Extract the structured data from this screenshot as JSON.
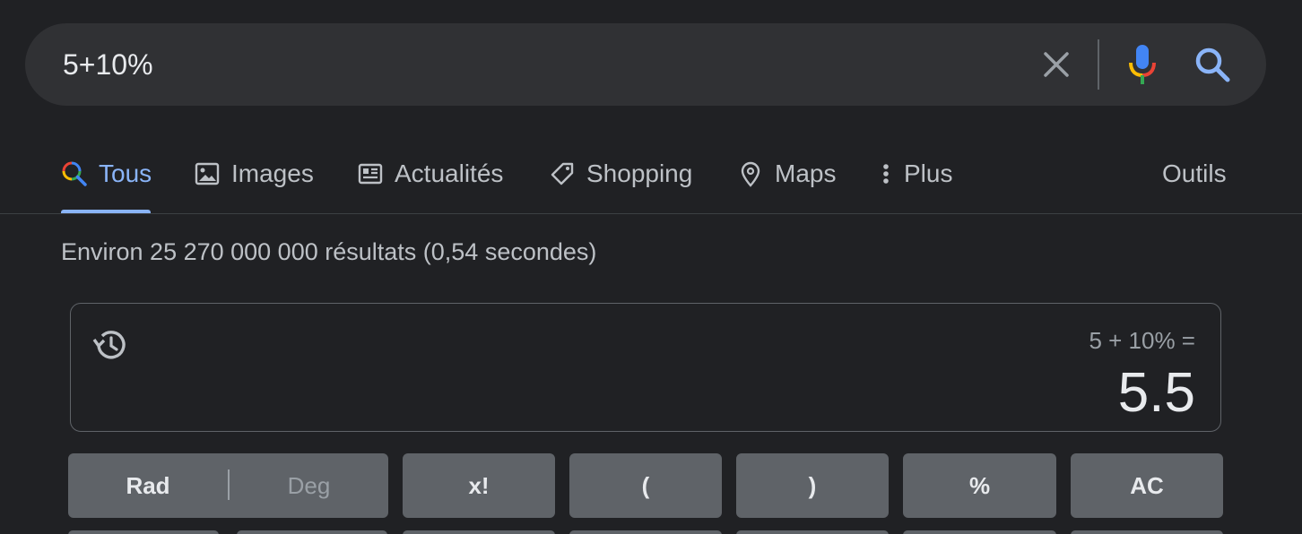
{
  "search": {
    "query": "5+10%"
  },
  "tabs": [
    {
      "label": "Tous",
      "icon": "search-multicolor-icon",
      "active": true
    },
    {
      "label": "Images",
      "icon": "image-icon"
    },
    {
      "label": "Actualités",
      "icon": "news-icon"
    },
    {
      "label": "Shopping",
      "icon": "tag-icon"
    },
    {
      "label": "Maps",
      "icon": "map-pin-icon"
    },
    {
      "label": "Plus",
      "icon": "more-vert-icon"
    }
  ],
  "tools_label": "Outils",
  "result_stats": "Environ 25 270 000 000 résultats (0,54 secondes)",
  "calculator": {
    "expression": "5 + 10% =",
    "result": "5.5",
    "keys": {
      "rad": "Rad",
      "deg": "Deg",
      "factorial": "x!",
      "open_paren": "(",
      "close_paren": ")",
      "percent": "%",
      "clear": "AC"
    }
  },
  "colors": {
    "background": "#202124",
    "search_bg": "#303134",
    "accent": "#8ab4f8",
    "key_bg": "#5f6368",
    "muted_text": "#bdc1c6"
  }
}
